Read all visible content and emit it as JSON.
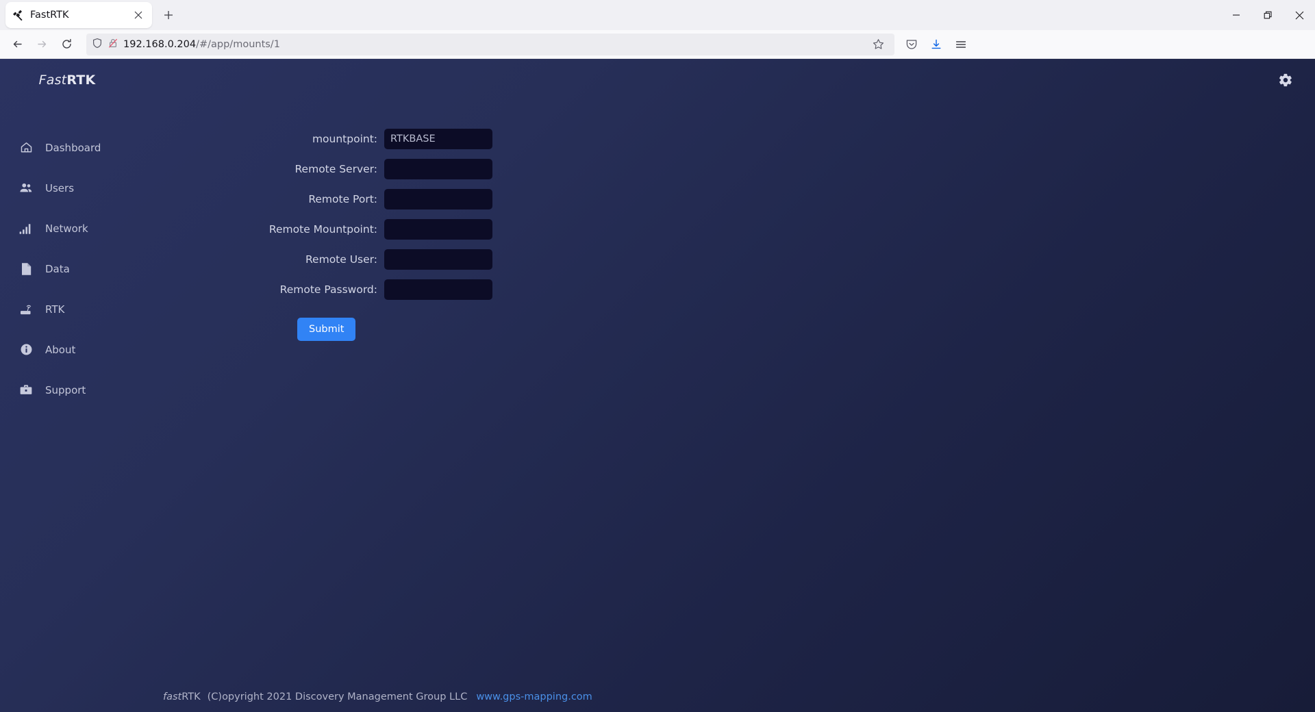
{
  "browser": {
    "tab": {
      "title": "FastRTK",
      "favicon_name": "satellite-favicon",
      "close_label": "×"
    },
    "new_tab_label": "+",
    "window_controls": {
      "minimize": "—",
      "restore": "❐",
      "close": "✕"
    },
    "nav": {
      "back_label": "←",
      "forward_label": "→",
      "reload_label": "⟳"
    },
    "url": {
      "host": "192.168.0.204",
      "path": "/#/app/mounts/1",
      "shield_icon": "shield-icon",
      "permission_icon": "blocked-lock-icon"
    },
    "toolbar": {
      "bookmark_icon": "star-icon",
      "pocket_icon": "pocket-icon",
      "downloads_icon": "download-icon",
      "menu_icon": "hamburger-menu-icon",
      "accent": "#0a64e6"
    }
  },
  "app": {
    "brand": {
      "first": "Fast",
      "second": "RTK"
    },
    "settings_icon": "gear-icon",
    "sidebar": {
      "items": [
        {
          "label": "Dashboard",
          "icon": "home-icon"
        },
        {
          "label": "Users",
          "icon": "users-icon"
        },
        {
          "label": "Network",
          "icon": "signal-bars-icon"
        },
        {
          "label": "Data",
          "icon": "document-icon"
        },
        {
          "label": "RTK",
          "icon": "router-icon"
        },
        {
          "label": "About",
          "icon": "info-circle-icon"
        },
        {
          "label": "Support",
          "icon": "briefcase-icon"
        }
      ]
    },
    "form": {
      "fields": [
        {
          "label": "mountpoint:",
          "value": "RTKBASE",
          "placeholder": "",
          "type": "text",
          "name": "mountpoint"
        },
        {
          "label": "Remote Server:",
          "value": "",
          "placeholder": "",
          "type": "text",
          "name": "remote-server"
        },
        {
          "label": "Remote Port:",
          "value": "",
          "placeholder": "",
          "type": "text",
          "name": "remote-port"
        },
        {
          "label": "Remote Mountpoint:",
          "value": "",
          "placeholder": "",
          "type": "text",
          "name": "remote-mountpoint"
        },
        {
          "label": "Remote User:",
          "value": "",
          "placeholder": "",
          "type": "text",
          "name": "remote-user"
        },
        {
          "label": "Remote Password:",
          "value": "",
          "placeholder": "",
          "type": "password",
          "name": "remote-password"
        }
      ],
      "submit_label": "Submit",
      "submit_color": "#3183f5"
    },
    "footer": {
      "brand_italic": "fast",
      "brand_rest": "RTK",
      "copyright": "(C)opyright 2021 Discovery Management Group LLC",
      "link": "www.gps-mapping.com",
      "link_color": "#4a90e8"
    }
  }
}
